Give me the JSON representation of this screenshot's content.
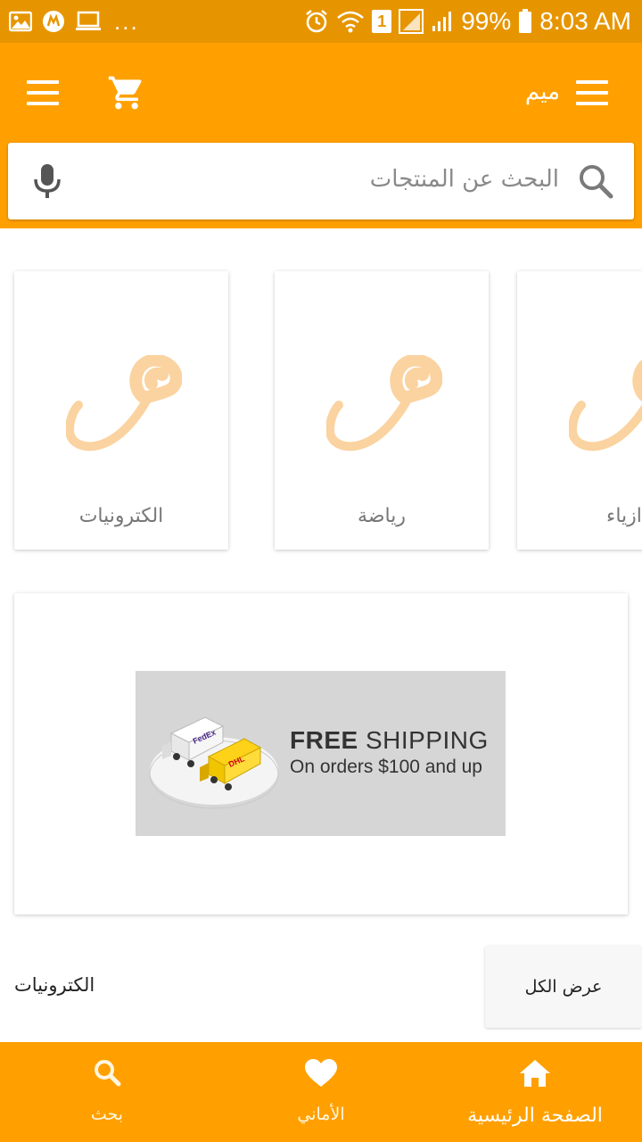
{
  "status_bar": {
    "overflow_dots": "...",
    "battery_percent": "99%",
    "time": "8:03 AM",
    "sim_badge": "1",
    "icons": [
      "image-icon",
      "app-notification-icon",
      "laptop-icon",
      "alarm-icon",
      "wifi-icon",
      "sim-signal-icon",
      "signal-icon",
      "battery-icon"
    ]
  },
  "app_bar": {
    "title": "ميم",
    "icons": [
      "menu-icon",
      "cart-icon",
      "menu-icon"
    ]
  },
  "search": {
    "placeholder": "البحث عن المنتجات",
    "icons": [
      "search-icon",
      "mic-icon"
    ]
  },
  "categories": [
    {
      "label": "الكترونيات"
    },
    {
      "label": "رياضة"
    },
    {
      "label": "ازياء"
    }
  ],
  "banner": {
    "title_bold": "FREE",
    "title_rest": " SHIPPING",
    "subtitle": "On orders $100 and up",
    "truck_labels": [
      "FedEx",
      "DHL"
    ]
  },
  "section": {
    "title": "الكترونيات",
    "view_all": "عرض الكل"
  },
  "bottom_nav": {
    "items": [
      {
        "label": "الصفحة الرئيسية",
        "icon": "home-icon"
      },
      {
        "label": "الأماني",
        "icon": "heart-icon"
      },
      {
        "label": "بحث",
        "icon": "search-icon"
      }
    ]
  },
  "colors": {
    "status_bar": "#E69500",
    "primary": "#FFA000",
    "logo_tint": "#FAD3A0"
  }
}
